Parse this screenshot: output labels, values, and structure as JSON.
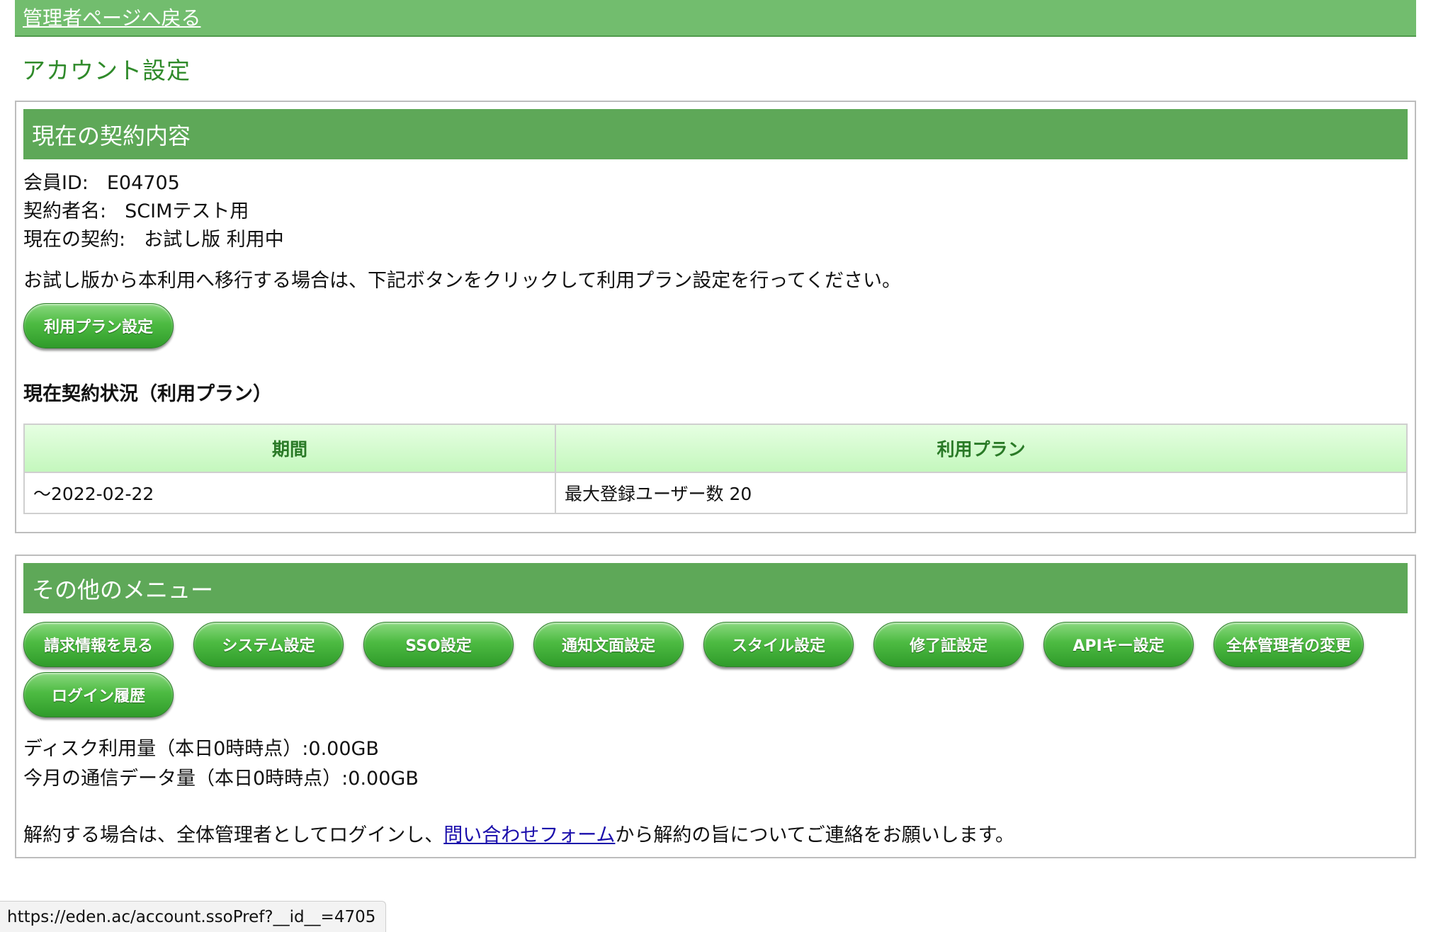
{
  "top_bar": {
    "back_link": "管理者ページへ戻る"
  },
  "page_title": "アカウント設定",
  "contract_panel": {
    "header": "現在の契約内容",
    "member_id_label": "会員ID:",
    "member_id_value": "E04705",
    "contractor_label": "契約者名:",
    "contractor_value": "SCIMテスト用",
    "contract_label": "現在の契約:",
    "contract_value": "お試し版 利用中",
    "migrate_text": "お試し版から本利用へ移行する場合は、下記ボタンをクリックして利用プラン設定を行ってください。",
    "plan_button": "利用プラン設定",
    "status_heading": "現在契約状況（利用プラン）",
    "table": {
      "headers": [
        "期間",
        "利用プラン"
      ],
      "rows": [
        [
          "～2022-02-22",
          "最大登録ユーザー数 20"
        ]
      ]
    }
  },
  "other_panel": {
    "header": "その他のメニュー",
    "buttons": [
      "請求情報を見る",
      "システム設定",
      "SSO設定",
      "通知文面設定",
      "スタイル設定",
      "修了証設定",
      "APIキー設定",
      "全体管理者の変更",
      "ログイン履歴"
    ],
    "disk_usage": "ディスク利用量（本日0時時点）:0.00GB",
    "traffic_usage": "今月の通信データ量（本日0時時点）:0.00GB",
    "cancel_prefix": "解約する場合は、全体管理者としてログインし、",
    "cancel_link": "問い合わせフォーム",
    "cancel_suffix": "から解約の旨についてご連絡をお願いします。"
  },
  "status_bar": {
    "url": "https://eden.ac/account.ssoPref?__id__=4705"
  }
}
